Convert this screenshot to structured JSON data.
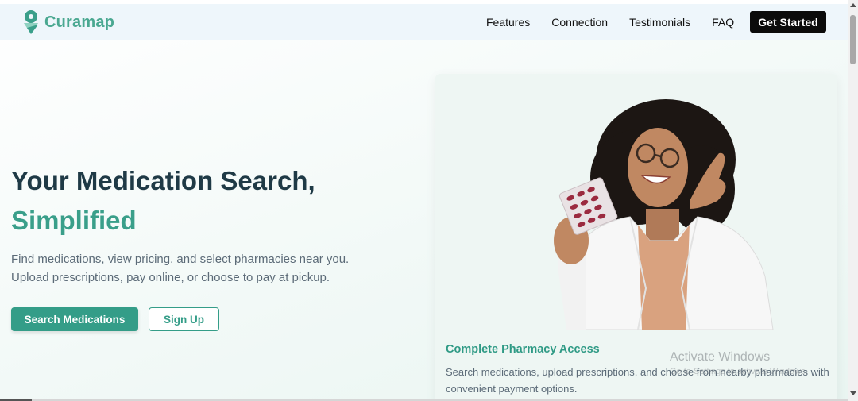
{
  "brand": {
    "name": "Curamap",
    "logo_icon": "map-pin-heart-icon",
    "colors": {
      "primary": "#349d88",
      "dark": "#1f3a46",
      "nav_bg": "#eef6fb"
    }
  },
  "nav": {
    "links": [
      "Features",
      "Connection",
      "Testimonials",
      "FAQ"
    ],
    "cta_label": "Get Started"
  },
  "hero": {
    "title_line1": "Your Medication Search,",
    "title_line2": "Simplified",
    "subtitle": "Find medications, view pricing, and select pharmacies near you. Upload prescriptions, pay online, or choose to pay at pickup.",
    "primary_button": "Search Medications",
    "secondary_button": "Sign Up"
  },
  "feature_card": {
    "image_icon": "pharmacist-photo",
    "title": "Complete Pharmacy Access",
    "description": "Search medications, upload prescriptions, and choose from nearby pharmacies with convenient payment options."
  },
  "system_overlay": {
    "watermark_title": "Activate Windows",
    "watermark_sub": "Go to Settings to activate Windows."
  }
}
